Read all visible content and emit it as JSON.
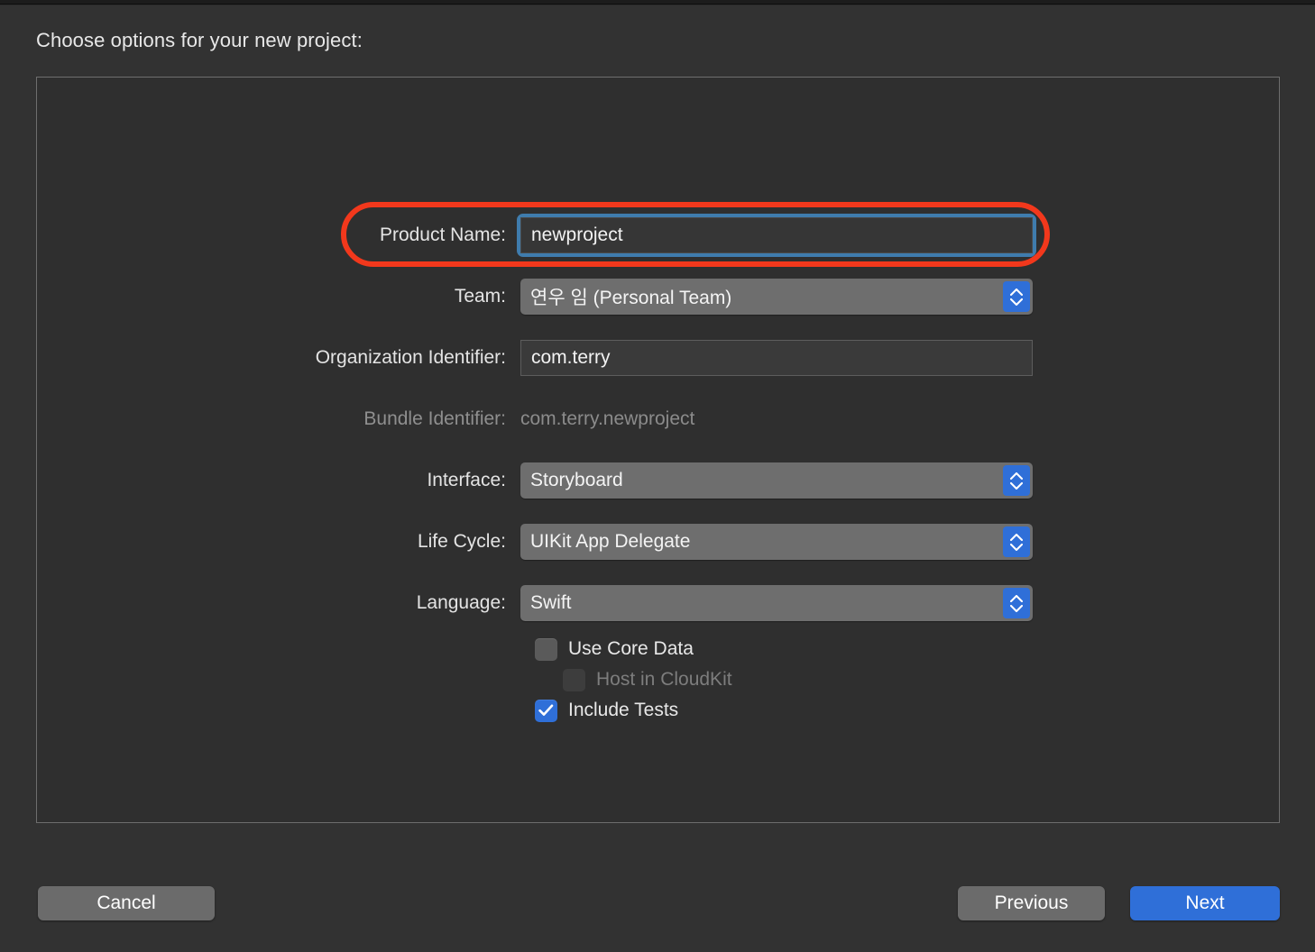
{
  "dialog": {
    "heading": "Choose options for your new project:"
  },
  "form": {
    "product_name": {
      "label": "Product Name:",
      "value": "newproject",
      "focused": true,
      "highlighted": true
    },
    "team": {
      "label": "Team:",
      "value": "연우 임 (Personal Team)"
    },
    "organization_identifier": {
      "label": "Organization Identifier:",
      "value": "com.terry"
    },
    "bundle_identifier": {
      "label": "Bundle Identifier:",
      "value": "com.terry.newproject"
    },
    "interface": {
      "label": "Interface:",
      "value": "Storyboard"
    },
    "life_cycle": {
      "label": "Life Cycle:",
      "value": "UIKit App Delegate"
    },
    "language": {
      "label": "Language:",
      "value": "Swift"
    }
  },
  "checkboxes": [
    {
      "label": "Use Core Data",
      "checked": false,
      "disabled": false
    },
    {
      "label": "Host in CloudKit",
      "checked": false,
      "disabled": true
    },
    {
      "label": "Include Tests",
      "checked": true,
      "disabled": false
    }
  ],
  "buttons": {
    "cancel": "Cancel",
    "previous": "Previous",
    "next": "Next"
  },
  "colors": {
    "window_background": "#323232",
    "panel_background": "#2f2f2f",
    "panel_border": "#6e6e6e",
    "accent_blue": "#2f6fd8",
    "focus_ring": "#3f7cad",
    "annotation_red": "#f2381c",
    "popup_background": "#6e6e6e",
    "textfield_background": "#3a3a3a",
    "disabled_text": "#7d7d7d"
  },
  "icons": {
    "stepper": "stepper-up-down-icon",
    "check": "checkmark-icon"
  }
}
